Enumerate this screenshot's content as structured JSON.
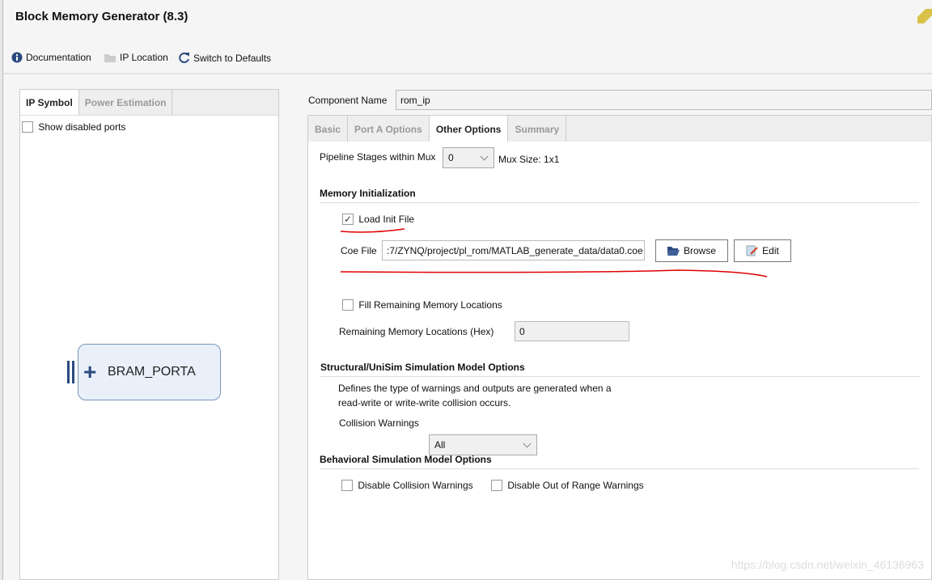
{
  "window": {
    "title": "Block Memory Generator (8.3)"
  },
  "toolbar": {
    "documentation": "Documentation",
    "ip_location": "IP Location",
    "switch_defaults": "Switch to Defaults"
  },
  "left": {
    "tabs": [
      "IP Symbol",
      "Power Estimation"
    ],
    "show_disabled": "Show disabled ports",
    "port": "BRAM_PORTA"
  },
  "component": {
    "label": "Component Name",
    "value": "rom_ip"
  },
  "tabs": [
    "Basic",
    "Port A Options",
    "Other Options",
    "Summary"
  ],
  "other": {
    "pipeline_label": "Pipeline Stages within Mux",
    "pipeline_value": "0",
    "mux_size": "Mux Size: 1x1",
    "mem_init": "Memory Initialization",
    "load_init": "Load Init File",
    "load_init_checked": true,
    "coe_label": "Coe File",
    "coe_value": ":7/ZYNQ/project/pl_rom/MATLAB_generate_data/data0.coe",
    "browse": "Browse",
    "edit": "Edit",
    "fill_remaining": "Fill Remaining Memory Locations",
    "remaining_label": "Remaining Memory Locations (Hex)",
    "remaining_value": "0",
    "structural": "Structural/UniSim Simulation Model Options",
    "desc1": "Defines the type of warnings and outputs are generated when a",
    "desc2": "read-write or write-write collision occurs.",
    "collision_label": "Collision Warnings",
    "collision_value": "All",
    "behavioral": "Behavioral Simulation Model Options",
    "disable_collision": "Disable Collision Warnings",
    "disable_range": "Disable Out of Range Warnings"
  },
  "watermark": "https://blog.csdn.net/weixin_46136963",
  "colors": {
    "annotation": "#e00000",
    "accent": "#2a4a80"
  }
}
